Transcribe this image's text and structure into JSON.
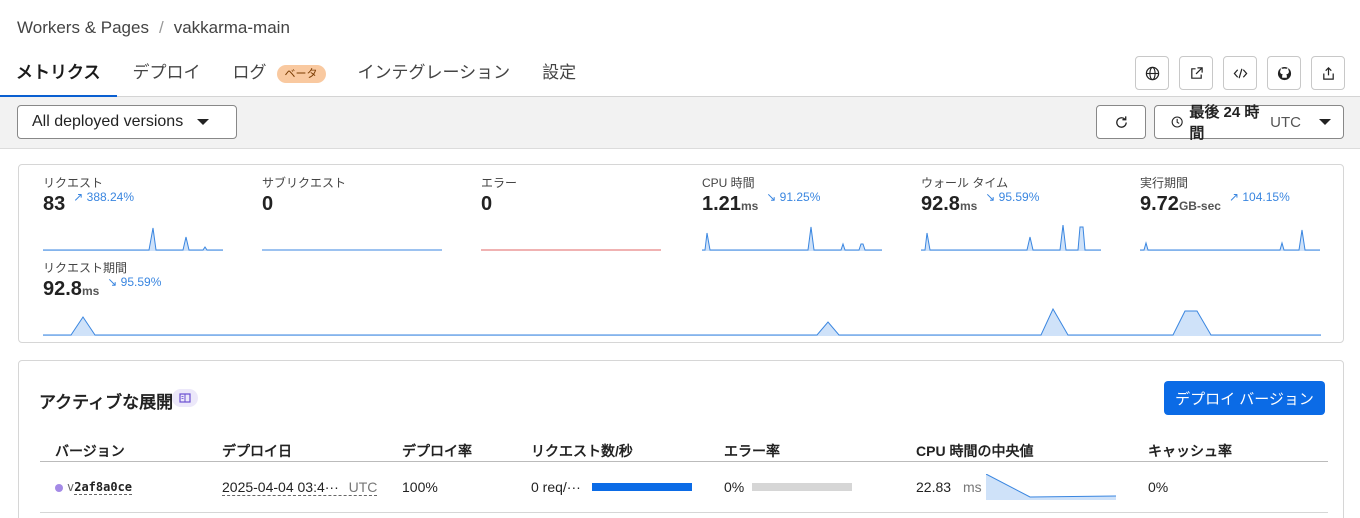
{
  "breadcrumb": {
    "root": "Workers & Pages",
    "separator": "/",
    "project": "vakkarma-main"
  },
  "tabs": [
    {
      "label": "メトリクス",
      "active": true
    },
    {
      "label": "デプロイ"
    },
    {
      "label": "ログ",
      "badge": "ベータ"
    },
    {
      "label": "インテグレーション"
    },
    {
      "label": "設定"
    }
  ],
  "header_icons": [
    "globe-icon",
    "external-link-icon",
    "code-icon",
    "github-icon",
    "share-icon"
  ],
  "toolbar": {
    "version_select": "All deployed versions",
    "time_range": "最後 24 時間",
    "timezone": "UTC"
  },
  "metrics": [
    {
      "label": "リクエスト",
      "value": "83",
      "unit": "",
      "delta": "388.24%",
      "trend": "up"
    },
    {
      "label": "サブリクエスト",
      "value": "0",
      "unit": ""
    },
    {
      "label": "エラー",
      "value": "0",
      "unit": ""
    },
    {
      "label": "CPU 時間",
      "value": "1.21",
      "unit": "ms",
      "delta": "91.25%",
      "trend": "down"
    },
    {
      "label": "ウォール タイム",
      "value": "92.8",
      "unit": "ms",
      "delta": "95.59%",
      "trend": "down"
    },
    {
      "label": "実行期間",
      "value": "9.72",
      "unit": "GB-sec",
      "delta": "104.15%",
      "trend": "up"
    },
    {
      "label": "リクエスト期間",
      "value": "92.8",
      "unit": "ms",
      "delta": "95.59%",
      "trend": "down"
    }
  ],
  "colors": {
    "accent": "#0b6be6",
    "spark": "#3a86e0",
    "error_spark": "#e06666",
    "badge": "#f9c9a0"
  },
  "deployments": {
    "title": "アクティブな展開",
    "deploy_button": "デプロイ バージョン",
    "columns": [
      "バージョン",
      "デプロイ日",
      "デプロイ率",
      "リクエスト数/秒",
      "エラー率",
      "CPU 時間の中央値",
      "キャッシュ率"
    ],
    "rows": [
      {
        "version_prefix": "v",
        "version": "2af8a0ce",
        "date": "2025-04-04 03:4···",
        "tz": "UTC",
        "rate": "100%",
        "rps": "0 req/···",
        "rps_bar": 1.0,
        "error_rate": "0%",
        "error_bar": 0.0,
        "cpu": "22.83",
        "cpu_unit": "ms",
        "cache": "0%"
      }
    ]
  }
}
